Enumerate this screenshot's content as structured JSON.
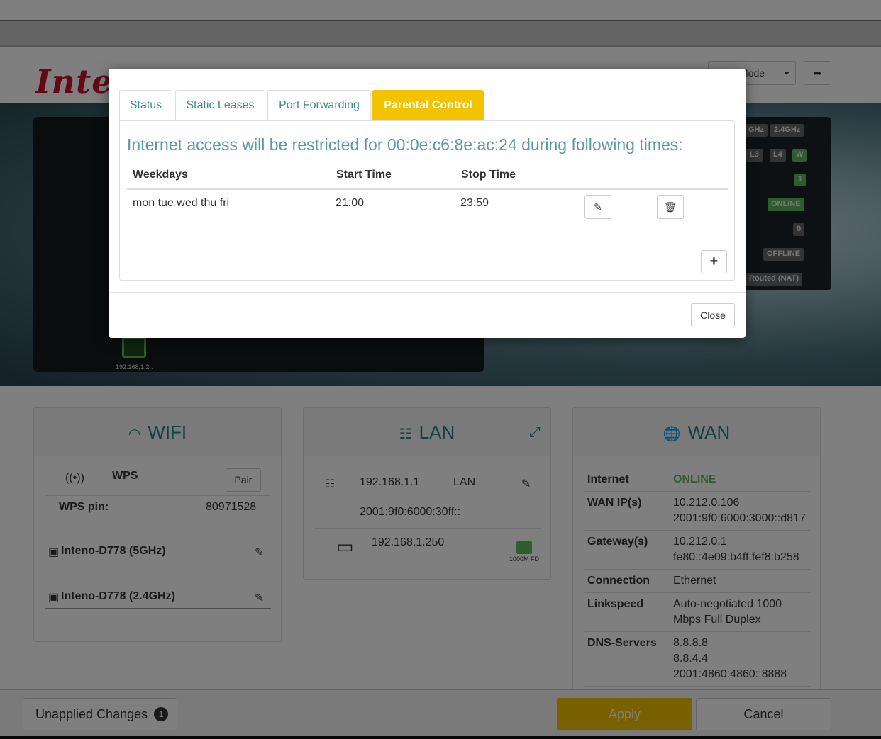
{
  "header": {
    "logo": "Inte",
    "mode_label": "Mode",
    "logout_icon": "logout-icon"
  },
  "hero": {
    "leds": [
      "GHz",
      "2.4GHz",
      "L3",
      "L4",
      "W",
      "1",
      "ONLINE",
      "0",
      "OFFLINE",
      "Routed (NAT)"
    ],
    "device_label": "192.168.1.2.."
  },
  "wifi": {
    "title": "WIFI",
    "wps_label": "WPS",
    "pair_label": "Pair",
    "wps_pin_label": "WPS pin:",
    "wps_pin_value": "80971528",
    "networks": [
      "Inteno-D778 (5GHz)",
      "Inteno-D778 (2.4GHz)"
    ]
  },
  "lan": {
    "title": "LAN",
    "ipv4": "192.168.1.1",
    "iface": "LAN",
    "ipv6": "2001:9f0:6000:30ff::",
    "client_ip": "192.168.1.250",
    "port_status": "1000M FD"
  },
  "wan": {
    "title": "WAN",
    "rows": [
      {
        "label": "Internet",
        "value": "ONLINE"
      },
      {
        "label": "WAN IP(s)",
        "value": "10.212.0.106",
        "value2": "2001:9f0:6000:3000::d817"
      },
      {
        "label": "Gateway(s)",
        "value": "10.212.0.1",
        "value2": "fe80::4e09:b4ff:fef8:b258"
      },
      {
        "label": "Connection",
        "value": "Ethernet"
      },
      {
        "label": "Linkspeed",
        "value": "Auto-negotiated 1000",
        "value2": "Mbps Full Duplex"
      },
      {
        "label": "DNS-Servers",
        "value": "8.8.8.8",
        "value2": "8.8.4.4",
        "value3": "2001:4860:4860::8888"
      }
    ]
  },
  "footer": {
    "unapplied_label": "Unapplied Changes",
    "unapplied_count": "1",
    "apply_label": "Apply",
    "cancel_label": "Cancel"
  },
  "modal": {
    "tabs": [
      "Status",
      "Static Leases",
      "Port Forwarding",
      "Parental Control"
    ],
    "active_tab": "Parental Control",
    "title": "Internet access will be restricted for 00:0e:c6:8e:ac:24 during following times:",
    "columns": [
      "Weekdays",
      "Start Time",
      "Stop Time"
    ],
    "rows": [
      {
        "weekdays": "mon tue wed thu fri",
        "start": "21:00",
        "stop": "23:59"
      }
    ],
    "add_label": "+",
    "close_label": "Close"
  },
  "colors": {
    "accent": "#f3c200",
    "teal": "#2a7f88",
    "online": "#5cb85c"
  }
}
